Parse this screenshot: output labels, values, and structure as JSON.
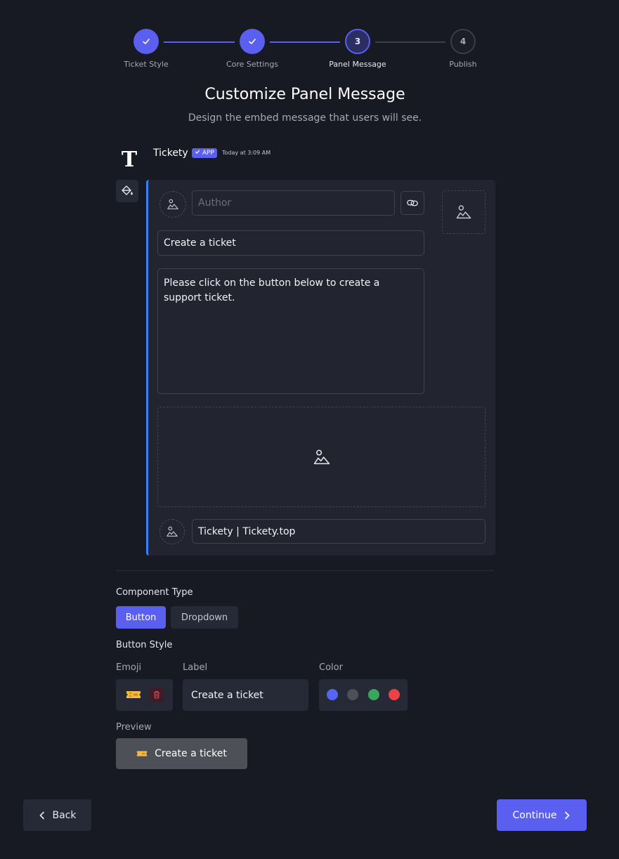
{
  "stepper": {
    "steps": [
      {
        "label": "Ticket Style",
        "state": "done",
        "num": ""
      },
      {
        "label": "Core Settings",
        "state": "done",
        "num": ""
      },
      {
        "label": "Panel Message",
        "state": "active",
        "num": "3"
      },
      {
        "label": "Publish",
        "state": "todo",
        "num": "4"
      }
    ]
  },
  "header": {
    "title": "Customize Panel Message",
    "subtitle": "Design the embed message that users will see."
  },
  "bot": {
    "avatar_letter": "T",
    "name": "Tickety",
    "badge": "APP",
    "timestamp": "Today at 3:09 AM"
  },
  "embed": {
    "accent_color": "#3b82f6",
    "author_placeholder": "Author",
    "title_value": "Create a ticket",
    "description_value": "Please click on the button below to create a support ticket.",
    "footer_value": "Tickety | Tickety.top"
  },
  "component": {
    "section_label": "Component Type",
    "types": [
      "Button",
      "Dropdown"
    ],
    "selected_type": "Button",
    "style_label": "Button Style",
    "emoji_label": "Emoji",
    "label_label": "Label",
    "color_label": "Color",
    "label_value": "Create a ticket",
    "colors": [
      "#5865f2",
      "#4e5058",
      "#3ba55d",
      "#ed4245"
    ],
    "preview_label": "Preview",
    "preview_text": "Create a ticket",
    "preview_color": "#4e5058"
  },
  "nav": {
    "back_label": "Back",
    "continue_label": "Continue"
  }
}
